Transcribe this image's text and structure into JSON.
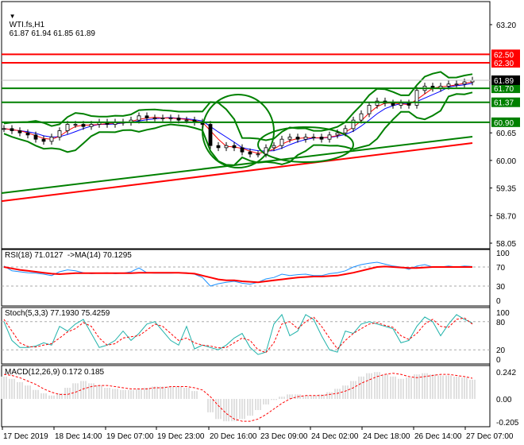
{
  "header": {
    "symbol_label": "WTI.fs,H1",
    "ohlc": "61.87 61.94 61.85 61.89",
    "menu_icon": "triangle-down-icon"
  },
  "colors": {
    "bg": "#ffffff",
    "support": "#008000",
    "resistance": "#ff0000",
    "rsi": "#1e90ff",
    "rsi_ma": "#ff0000",
    "stoch_main": "#20b2aa",
    "stoch_signal": "#ff0000",
    "macd_hist": "#c0c0c0",
    "macd_signal": "#ff0000",
    "band": "#008000",
    "candle": "#000000"
  },
  "chart_data": [
    {
      "type": "line",
      "title": "WTI.fs,H1",
      "ylim": [
        58.05,
        63.45
      ],
      "y_ticks": [
        "63.20",
        "60.65",
        "60.00",
        "59.35",
        "58.70",
        "58.05"
      ],
      "current_price": "61.89",
      "levels": [
        {
          "label": "62.50",
          "value": 62.5,
          "kind": "resistance"
        },
        {
          "label": "62.30",
          "value": 62.3,
          "kind": "resistance"
        },
        {
          "label": "61.70",
          "value": 61.7,
          "kind": "support"
        },
        {
          "label": "61.37",
          "value": 61.37,
          "kind": "support"
        },
        {
          "label": "60.90",
          "value": 60.9,
          "kind": "support"
        }
      ],
      "close": [
        60.75,
        60.7,
        60.65,
        60.6,
        60.5,
        60.45,
        60.55,
        60.7,
        60.85,
        60.85,
        60.8,
        60.85,
        60.9,
        60.85,
        60.9,
        60.9,
        60.95,
        61.05,
        61.0,
        61.0,
        61.0,
        61.0,
        60.95,
        60.95,
        60.9,
        60.85,
        60.35,
        60.3,
        60.35,
        60.3,
        60.2,
        60.15,
        60.15,
        60.3,
        60.35,
        60.5,
        60.55,
        60.5,
        60.55,
        60.55,
        60.5,
        60.6,
        60.65,
        60.75,
        60.95,
        61.1,
        61.3,
        61.4,
        61.35,
        61.3,
        61.35,
        61.3,
        61.65,
        61.75,
        61.7,
        61.75,
        61.8,
        61.8,
        61.85,
        61.89
      ],
      "ma_long_green": [
        59.23,
        60.56
      ],
      "ma_long_red": [
        59.04,
        60.41
      ]
    },
    {
      "type": "line",
      "title": "RSI(18) 71.0127  ->MA(14) 70.1295",
      "ylim": [
        0,
        100
      ],
      "y_ticks": [
        "100",
        "70",
        "30",
        "0"
      ],
      "levels": [
        70,
        30
      ],
      "series": [
        {
          "name": "RSI(18)",
          "values": [
            72,
            62,
            60,
            58,
            57,
            55,
            52,
            60,
            64,
            62,
            58,
            56,
            57,
            58,
            56,
            57,
            60,
            68,
            58,
            57,
            57,
            57,
            58,
            58,
            55,
            48,
            30,
            35,
            38,
            40,
            36,
            34,
            38,
            45,
            48,
            55,
            52,
            54,
            55,
            52,
            52,
            56,
            58,
            62,
            70,
            75,
            78,
            80,
            76,
            72,
            70,
            65,
            72,
            75,
            70,
            70,
            72,
            70,
            72,
            71
          ]
        },
        {
          "name": "MA(14)",
          "values": [
            70,
            67,
            64,
            62,
            60,
            58,
            56,
            55,
            56,
            57,
            57,
            57,
            57,
            57,
            57,
            57,
            57,
            58,
            58,
            58,
            58,
            58,
            58,
            57,
            56,
            52,
            48,
            44,
            42,
            42,
            40,
            39,
            38,
            40,
            42,
            44,
            46,
            48,
            49,
            50,
            50,
            51,
            52,
            55,
            58,
            62,
            66,
            70,
            71,
            70,
            69,
            68,
            68,
            69,
            70,
            70,
            70,
            70,
            70,
            70
          ]
        }
      ]
    },
    {
      "type": "line",
      "title": "Stoch(5,3,3) 77.1930 75.4259",
      "ylim": [
        0,
        100
      ],
      "y_ticks": [
        "100",
        "80",
        "20",
        "0"
      ],
      "levels": [
        80,
        20
      ],
      "series": [
        {
          "name": "main",
          "values": [
            80,
            40,
            25,
            25,
            28,
            35,
            30,
            70,
            60,
            75,
            85,
            55,
            25,
            30,
            40,
            60,
            40,
            55,
            75,
            80,
            60,
            40,
            30,
            70,
            22,
            30,
            25,
            20,
            30,
            45,
            55,
            25,
            10,
            15,
            75,
            95,
            50,
            60,
            95,
            85,
            50,
            20,
            15,
            60,
            55,
            75,
            80,
            75,
            70,
            65,
            35,
            40,
            70,
            90,
            80,
            50,
            75,
            95,
            85,
            77
          ]
        },
        {
          "name": "signal",
          "values": [
            85,
            60,
            35,
            27,
            26,
            30,
            33,
            45,
            58,
            65,
            78,
            70,
            45,
            30,
            33,
            45,
            48,
            50,
            62,
            75,
            70,
            55,
            40,
            45,
            35,
            30,
            28,
            24,
            25,
            35,
            45,
            40,
            20,
            14,
            35,
            75,
            80,
            65,
            80,
            90,
            70,
            45,
            22,
            40,
            55,
            65,
            75,
            78,
            72,
            68,
            50,
            42,
            55,
            75,
            85,
            70,
            68,
            85,
            88,
            75
          ]
        }
      ]
    },
    {
      "type": "bar",
      "title": "MACD(12,26,9) 0.172 0.185",
      "ylim": [
        -0.205,
        0.242
      ],
      "y_ticks": [
        "0.242",
        "0.00",
        "-0.205"
      ],
      "series": [
        {
          "name": "histogram",
          "values": [
            0.2,
            0.18,
            0.15,
            0.12,
            0.08,
            0.05,
            0.03,
            0.05,
            0.1,
            0.14,
            0.16,
            0.14,
            0.12,
            0.1,
            0.09,
            0.08,
            0.08,
            0.09,
            0.1,
            0.11,
            0.11,
            0.11,
            0.11,
            0.1,
            0.07,
            0.0,
            -0.12,
            -0.18,
            -0.2,
            -0.2,
            -0.18,
            -0.15,
            -0.1,
            -0.05,
            -0.01,
            0.02,
            0.04,
            0.04,
            0.03,
            0.03,
            0.04,
            0.06,
            0.09,
            0.12,
            0.16,
            0.2,
            0.23,
            0.24,
            0.22,
            0.2,
            0.18,
            0.19,
            0.22,
            0.23,
            0.22,
            0.21,
            0.21,
            0.2,
            0.19,
            0.172
          ]
        },
        {
          "name": "signal",
          "values": [
            0.22,
            0.21,
            0.19,
            0.16,
            0.13,
            0.09,
            0.06,
            0.04,
            0.04,
            0.06,
            0.09,
            0.11,
            0.12,
            0.12,
            0.11,
            0.1,
            0.09,
            0.09,
            0.09,
            0.1,
            0.1,
            0.11,
            0.11,
            0.11,
            0.1,
            0.08,
            0.02,
            -0.06,
            -0.13,
            -0.18,
            -0.2,
            -0.2,
            -0.18,
            -0.14,
            -0.09,
            -0.04,
            0.0,
            0.02,
            0.03,
            0.03,
            0.03,
            0.04,
            0.05,
            0.07,
            0.1,
            0.14,
            0.17,
            0.2,
            0.22,
            0.23,
            0.22,
            0.2,
            0.19,
            0.2,
            0.21,
            0.22,
            0.22,
            0.21,
            0.2,
            0.185
          ]
        }
      ]
    }
  ],
  "x_axis": {
    "labels": [
      "17 Dec 2019",
      "18 Dec 14:00",
      "19 Dec 07:00",
      "19 Dec 23:00",
      "20 Dec 16:00",
      "23 Dec 09:00",
      "24 Dec 02:00",
      "24 Dec 18:00",
      "26 Dec 14:00",
      "27 Dec 07:00"
    ]
  }
}
